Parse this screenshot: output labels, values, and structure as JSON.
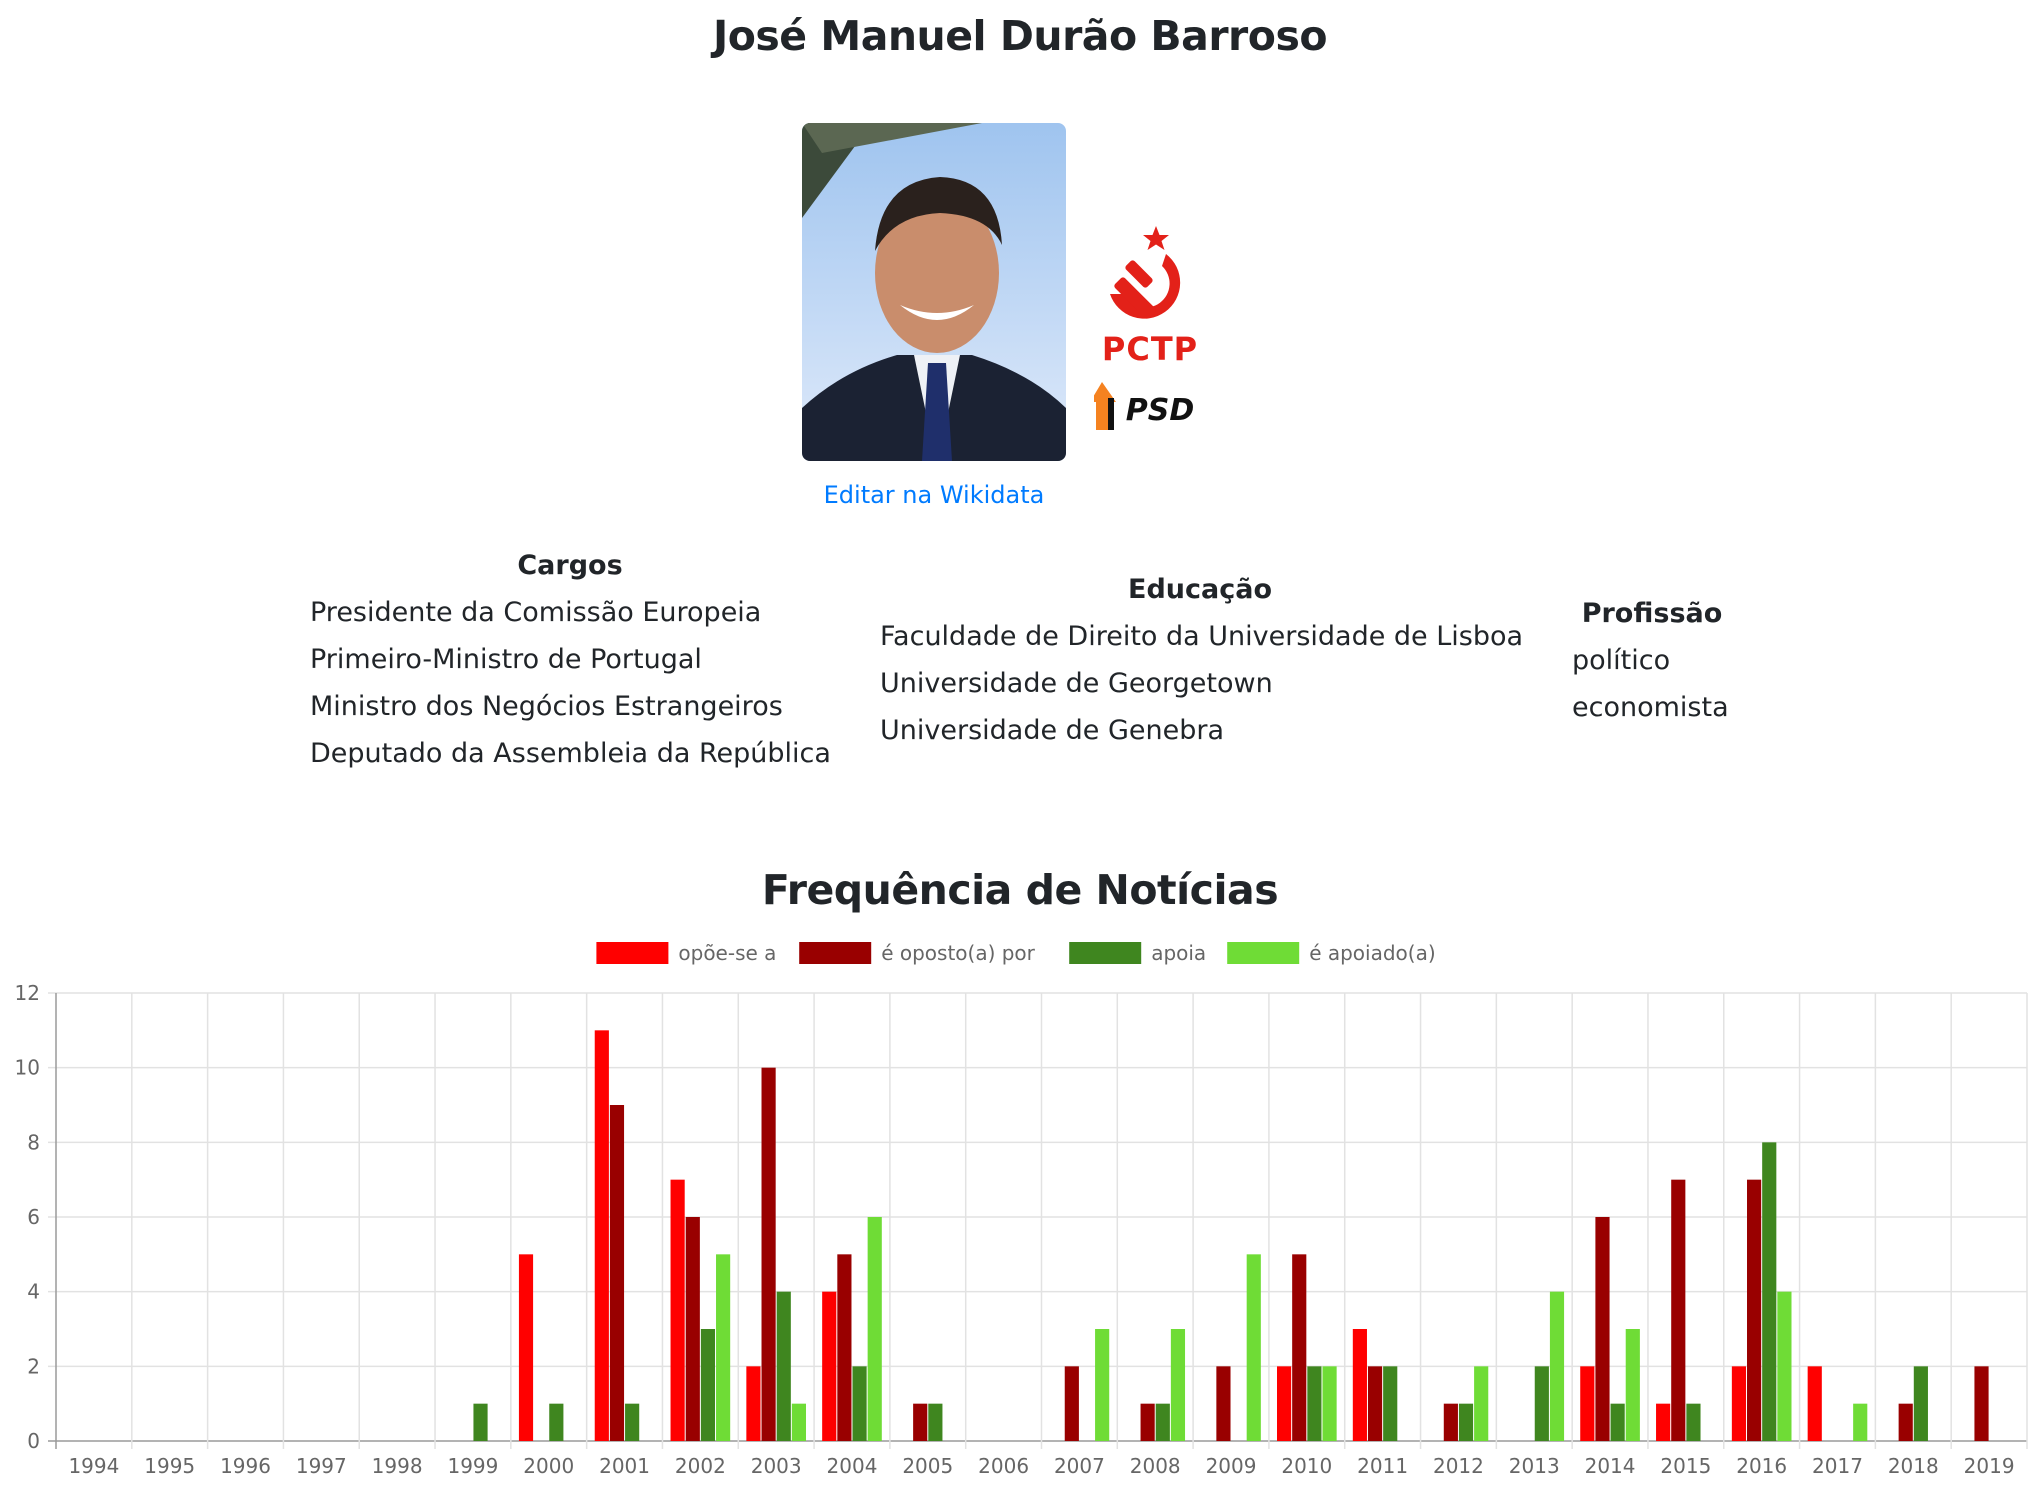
{
  "person": {
    "name": "José Manuel Durão Barroso",
    "edit_link": "Editar na Wikidata"
  },
  "logos": {
    "pctp_text": "PCTP",
    "psd_text": "PSD"
  },
  "info": {
    "cargos": {
      "title": "Cargos",
      "items": [
        "Presidente da Comissão Europeia",
        "Primeiro-Ministro de Portugal",
        "Ministro dos Negócios Estrangeiros",
        "Deputado da Assembleia da República"
      ]
    },
    "educacao": {
      "title": "Educação",
      "items": [
        "Faculdade de Direito da Universidade de Lisboa",
        "Universidade de Georgetown",
        "Universidade de Genebra"
      ]
    },
    "profissao": {
      "title": "Profissão",
      "items": [
        "político",
        "economista"
      ]
    }
  },
  "chart_title": "Frequência de Notícias",
  "chart_data": {
    "type": "bar",
    "categories": [
      "1994",
      "1995",
      "1996",
      "1997",
      "1998",
      "1999",
      "2000",
      "2001",
      "2002",
      "2003",
      "2004",
      "2005",
      "2006",
      "2007",
      "2008",
      "2009",
      "2010",
      "2011",
      "2012",
      "2013",
      "2014",
      "2015",
      "2016",
      "2017",
      "2018",
      "2019"
    ],
    "series": [
      {
        "name": "opõe-se a",
        "color": "#ff0000",
        "values": [
          0,
          0,
          0,
          0,
          0,
          0,
          5,
          11,
          7,
          2,
          4,
          0,
          0,
          0,
          0,
          0,
          2,
          3,
          0,
          0,
          2,
          1,
          2,
          2,
          0,
          0
        ]
      },
      {
        "name": "é oposto(a) por",
        "color": "#990000",
        "values": [
          0,
          0,
          0,
          0,
          0,
          0,
          0,
          9,
          6,
          10,
          5,
          1,
          0,
          2,
          1,
          2,
          5,
          2,
          1,
          0,
          6,
          7,
          7,
          0,
          1,
          2
        ]
      },
      {
        "name": "apoia",
        "color": "#3f861f",
        "values": [
          0,
          0,
          0,
          0,
          0,
          1,
          1,
          1,
          3,
          4,
          2,
          1,
          0,
          0,
          1,
          0,
          2,
          2,
          1,
          2,
          1,
          1,
          8,
          0,
          2,
          0
        ]
      },
      {
        "name": "é apoiado(a)",
        "color": "#6fdc36",
        "values": [
          0,
          0,
          0,
          0,
          0,
          0,
          0,
          0,
          5,
          1,
          6,
          0,
          0,
          3,
          3,
          5,
          2,
          0,
          2,
          4,
          3,
          0,
          4,
          1,
          0,
          0
        ]
      }
    ],
    "ylim": [
      0,
      12
    ],
    "yticks": [
      0,
      2,
      4,
      6,
      8,
      10,
      12
    ],
    "grid": true,
    "legend_position": "top-center"
  }
}
